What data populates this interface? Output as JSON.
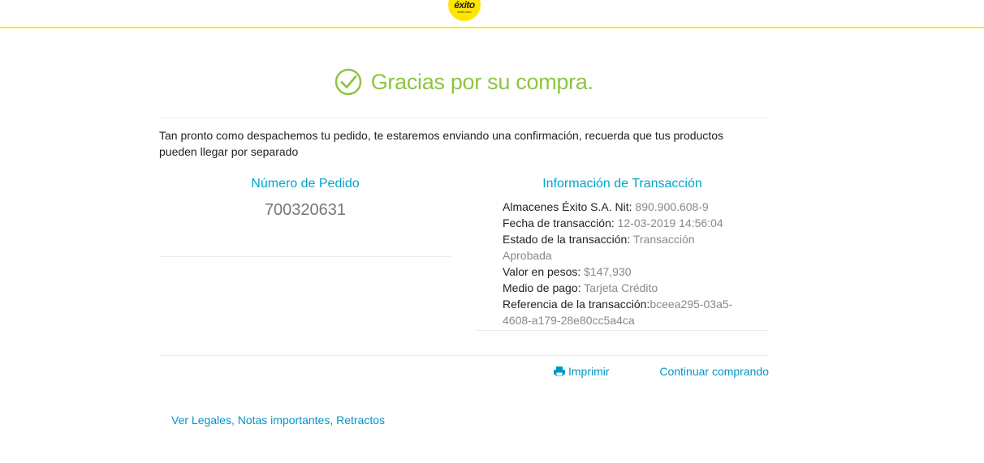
{
  "header": {
    "logo_text": "éxito",
    "logo_subtext": "éxito.com"
  },
  "confirmation": {
    "title": "Gracias por su compra.",
    "intro": "Tan pronto como despachemos tu pedido, te estaremos enviando una confirmación, recuerda que tus productos pueden llegar por separado"
  },
  "order": {
    "heading": "Número de Pedido",
    "number": "700320631"
  },
  "transaction": {
    "heading": "Información de Transacción",
    "fields": [
      {
        "label": "Almacenes Éxito S.A. Nit: ",
        "value": "890.900.608-9"
      },
      {
        "label": "Fecha de transacción: ",
        "value": "12-03-2019 14:56:04"
      },
      {
        "label": "Estado de la transacción: ",
        "value": "Transacción Aprobada"
      },
      {
        "label": "Valor en pesos: ",
        "value": "$147,930"
      },
      {
        "label": "Medio de pago: ",
        "value": "Tarjeta Crédito"
      },
      {
        "label": "Referencia de la transacción:",
        "value": "bceea295-03a5-4608-a179-28e80cc5a4ca"
      }
    ]
  },
  "actions": {
    "print_label": "Imprimir",
    "continue_label": "Continuar comprando"
  },
  "footer": {
    "legal_link": "Ver Legales, Notas importantes, Retractos"
  },
  "colors": {
    "accent_green": "#8cc63f",
    "link_blue": "#0096c8",
    "heading_teal": "#00a6c8",
    "brand_yellow": "#ffe600"
  },
  "icons": {
    "success": "check-circle-icon",
    "print": "printer-icon"
  }
}
